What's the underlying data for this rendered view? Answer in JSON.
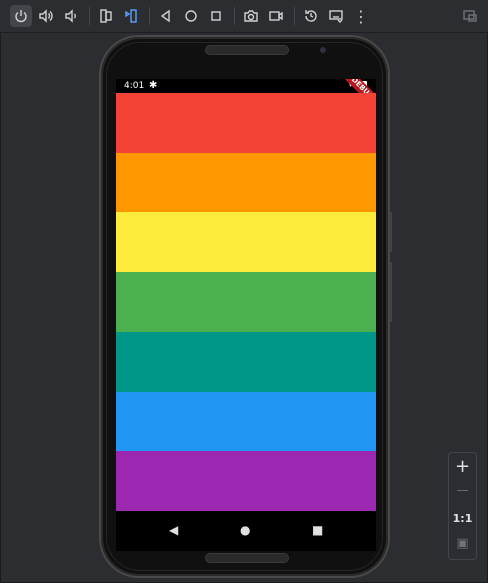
{
  "toolbar": {
    "items": [
      {
        "name": "power-button",
        "icon": "power-icon",
        "active": true
      },
      {
        "name": "volume-up-button",
        "icon": "volume-up-icon"
      },
      {
        "name": "volume-down-button",
        "icon": "volume-down-icon"
      },
      {
        "name": "rotate-left-button",
        "icon": "rotate-left-icon"
      },
      {
        "name": "rotate-right-button",
        "icon": "rotate-right-icon"
      },
      {
        "name": "back-button",
        "icon": "triangle-back-icon"
      },
      {
        "name": "home-button",
        "icon": "circle-home-icon"
      },
      {
        "name": "overview-button",
        "icon": "square-overview-icon"
      },
      {
        "name": "screenshot-button",
        "icon": "camera-icon"
      },
      {
        "name": "screen-record-button",
        "icon": "video-camera-icon"
      },
      {
        "name": "snapshot-restore-button",
        "icon": "history-icon"
      },
      {
        "name": "keyboard-button",
        "icon": "keyboard-icon"
      },
      {
        "name": "more-button",
        "icon": "more-vertical-icon"
      },
      {
        "name": "detach-button",
        "icon": "detach-window-icon",
        "disabled": true
      }
    ],
    "more_glyph": "⋮"
  },
  "device": {
    "status_time": "4:01",
    "status_gear_glyph": "✱",
    "status_wifi_glyph": "▾",
    "debug_banner": "DEBUG",
    "stripe_colors": [
      "#f44336",
      "#ff9800",
      "#ffeb3b",
      "#4caf50",
      "#009688",
      "#2196f3",
      "#9c27b0"
    ],
    "nav": {
      "back": "◀",
      "home": "●",
      "overview": "■"
    }
  },
  "zoom_panel": {
    "zoom_in": "+",
    "zoom_out": "—",
    "actual_size": "1:1",
    "fit_glyph": "▣"
  }
}
